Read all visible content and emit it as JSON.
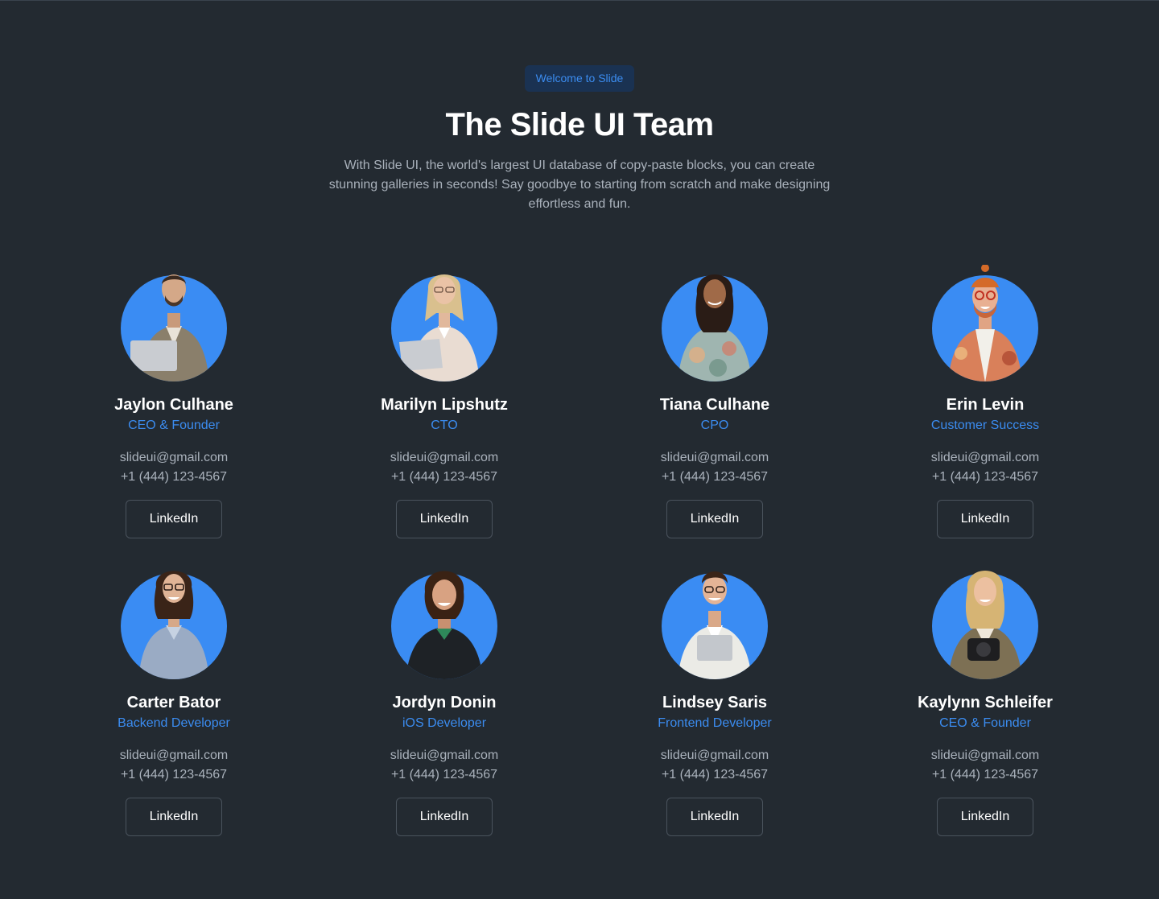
{
  "header": {
    "badge": "Welcome to Slide",
    "title": "The Slide UI Team",
    "subtitle": "With Slide UI, the world's largest UI database of copy-paste blocks, you can create stunning galleries in seconds! Say goodbye to starting from scratch and make designing effortless and fun."
  },
  "colors": {
    "background": "#232a31",
    "accent": "#3b8cf0",
    "avatar_bg": "#3a8cf3",
    "text_primary": "#ffffff",
    "text_secondary": "#a9b1bb"
  },
  "team": [
    {
      "name": "Jaylon Culhane",
      "role": "CEO & Founder",
      "email": "slideui@gmail.com",
      "phone": "+1 (444) 123-4567",
      "button": "LinkedIn"
    },
    {
      "name": "Marilyn Lipshutz",
      "role": "CTO",
      "email": "slideui@gmail.com",
      "phone": "+1 (444) 123-4567",
      "button": "LinkedIn"
    },
    {
      "name": "Tiana Culhane",
      "role": "CPO",
      "email": "slideui@gmail.com",
      "phone": "+1 (444) 123-4567",
      "button": "LinkedIn"
    },
    {
      "name": "Erin Levin",
      "role": "Customer Success",
      "email": "slideui@gmail.com",
      "phone": "+1 (444) 123-4567",
      "button": "LinkedIn"
    },
    {
      "name": "Carter Bator",
      "role": "Backend Developer",
      "email": "slideui@gmail.com",
      "phone": "+1 (444) 123-4567",
      "button": "LinkedIn"
    },
    {
      "name": "Jordyn Donin",
      "role": "iOS Developer",
      "email": "slideui@gmail.com",
      "phone": "+1 (444) 123-4567",
      "button": "LinkedIn"
    },
    {
      "name": "Lindsey Saris",
      "role": "Frontend Developer",
      "email": "slideui@gmail.com",
      "phone": "+1 (444) 123-4567",
      "button": "LinkedIn"
    },
    {
      "name": "Kaylynn Schleifer",
      "role": "CEO & Founder",
      "email": "slideui@gmail.com",
      "phone": "+1 (444) 123-4567",
      "button": "LinkedIn"
    }
  ]
}
